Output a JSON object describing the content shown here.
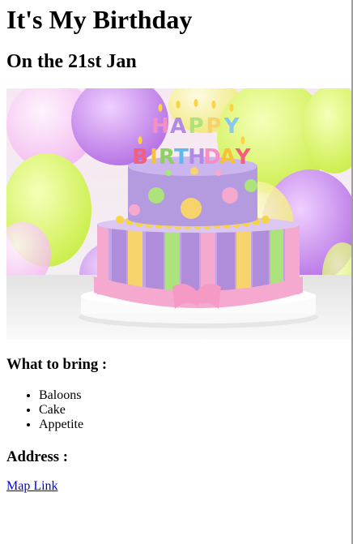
{
  "page": {
    "title": "It's My Birthday",
    "subtitle": "On the 21st Jan",
    "image_letters": "HAPPY BIRTHDAY",
    "bring_heading": "What to bring :",
    "bring_items": [
      "Baloons",
      "Cake",
      "Appetite"
    ],
    "address_heading": "Address :",
    "map_link": "Map Link"
  },
  "colors": {
    "link": "#0000ee",
    "text": "#000000",
    "background": "#ffffff"
  }
}
